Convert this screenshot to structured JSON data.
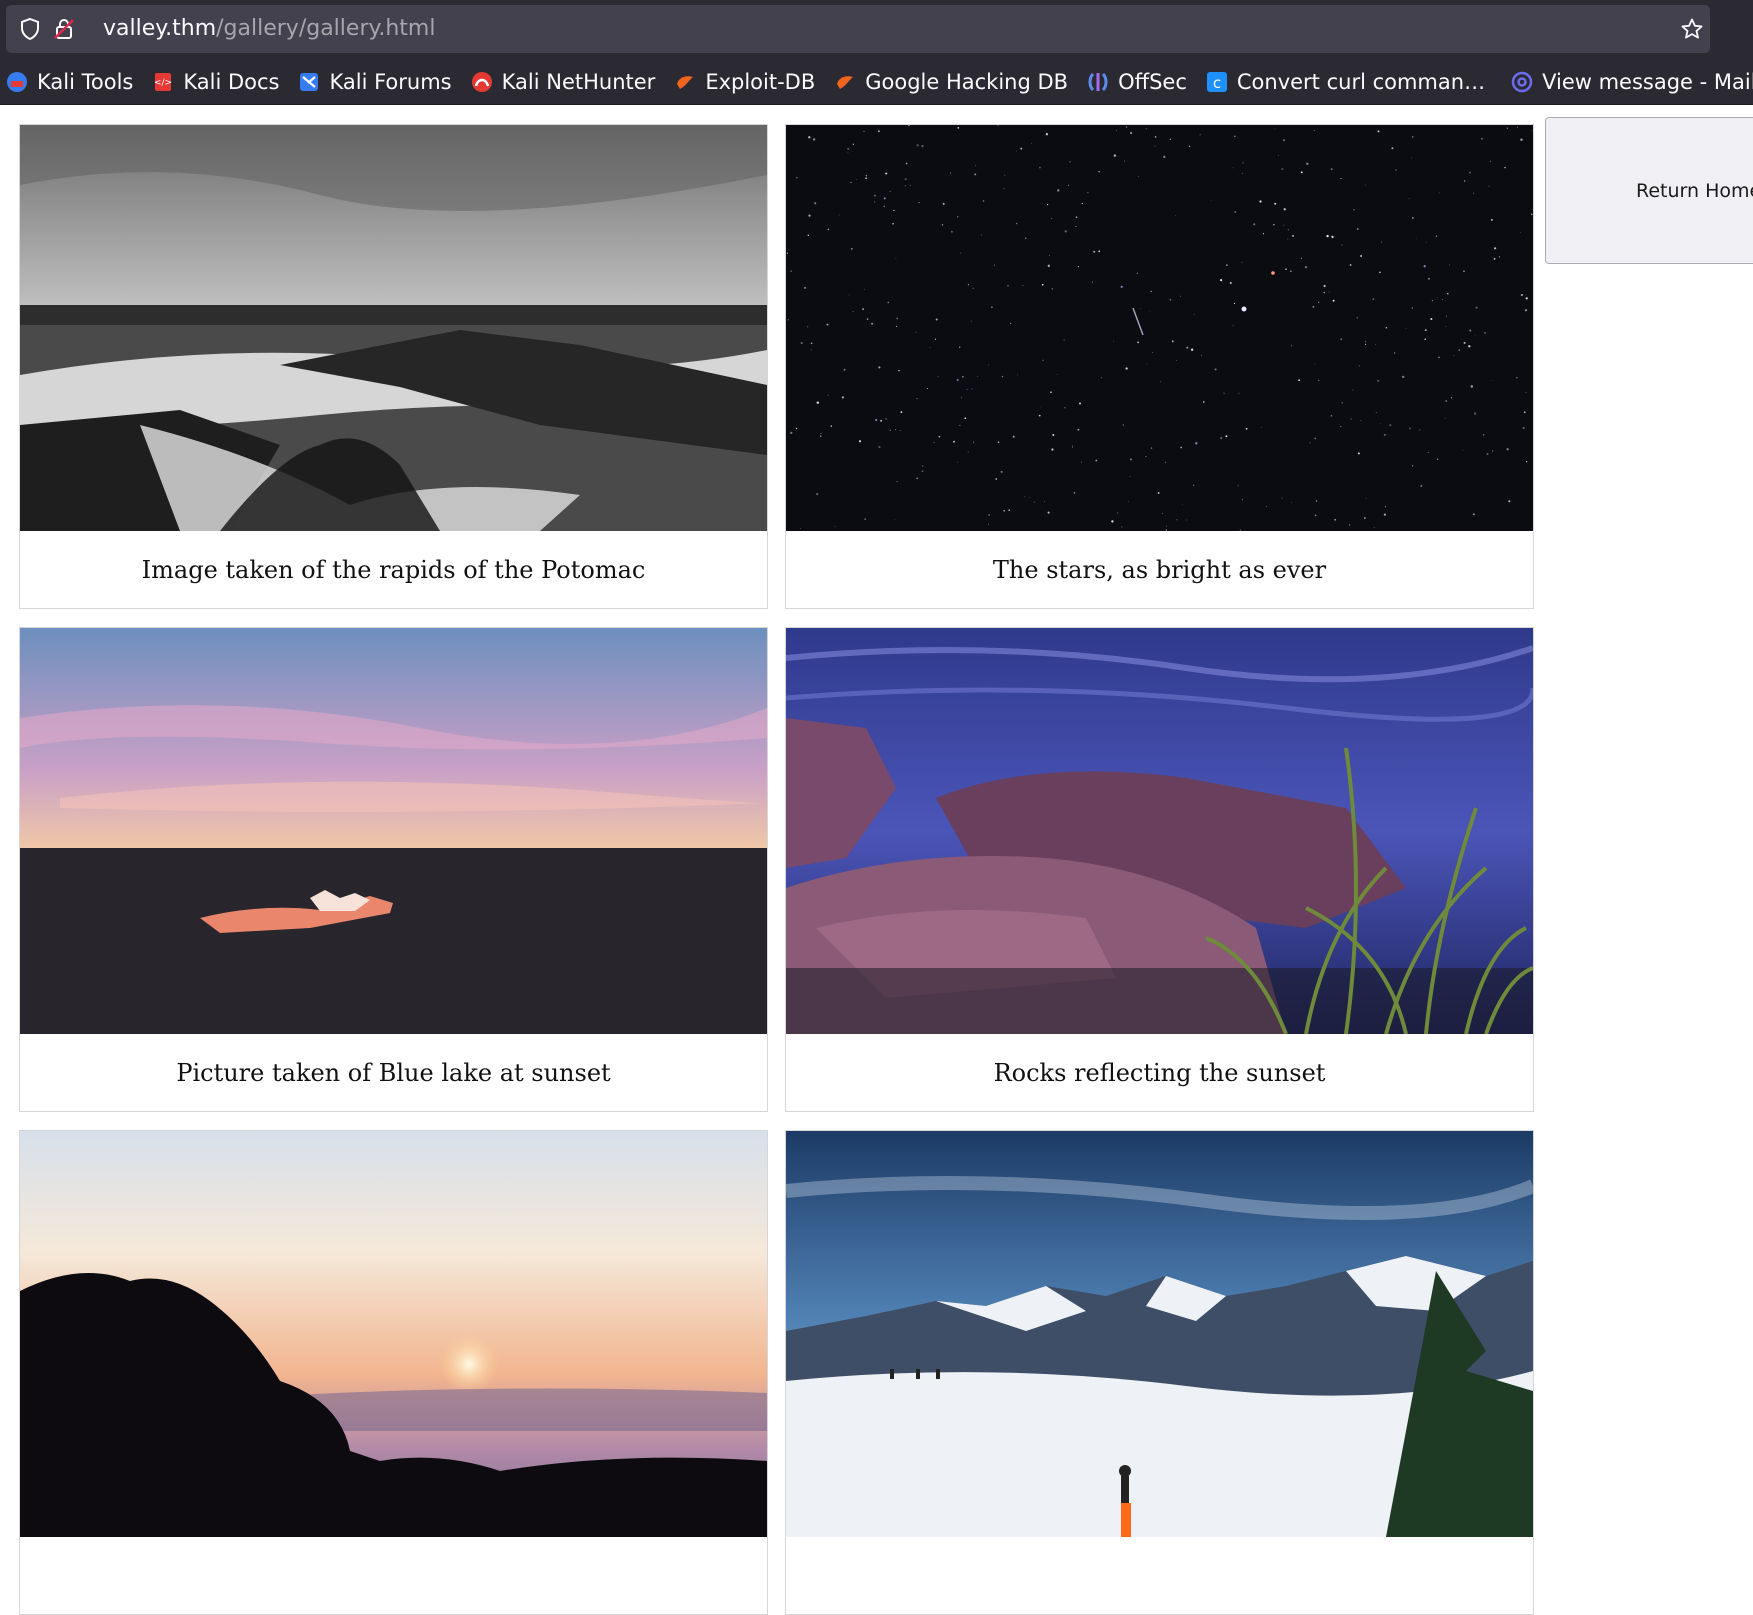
{
  "browser": {
    "url_host": "valley.thm",
    "url_path": "/gallery/gallery.html",
    "icons": {
      "shield": "shield-icon",
      "lock": "lock-warning-icon",
      "star": "bookmark-star-icon"
    },
    "bookmarks": [
      {
        "label": "Kali Tools",
        "icon": "kali-tools-icon"
      },
      {
        "label": "Kali Docs",
        "icon": "kali-docs-icon"
      },
      {
        "label": "Kali Forums",
        "icon": "kali-forums-icon"
      },
      {
        "label": "Kali NetHunter",
        "icon": "kali-nethunter-icon"
      },
      {
        "label": "Exploit-DB",
        "icon": "exploit-db-icon"
      },
      {
        "label": "Google Hacking DB",
        "icon": "ghdb-icon"
      },
      {
        "label": "OffSec",
        "icon": "offsec-icon"
      },
      {
        "label": "Convert curl comman…",
        "icon": "curl-converter-icon"
      },
      {
        "label": "View message - Mail.tm",
        "icon": "mailtm-icon"
      }
    ]
  },
  "page": {
    "return_home_label": "Return Home",
    "gallery": [
      {
        "caption": "Image taken of the rapids of the Potomac",
        "image": "rapids-photo"
      },
      {
        "caption": "The stars, as bright as ever",
        "image": "stars-photo"
      },
      {
        "caption": "Picture taken of Blue lake at sunset",
        "image": "lake-sunset-photo"
      },
      {
        "caption": "Rocks reflecting the sunset",
        "image": "rocks-sunset-photo"
      },
      {
        "caption": "",
        "image": "sunset-trees-photo"
      },
      {
        "caption": "",
        "image": "ski-mountains-photo"
      }
    ]
  }
}
